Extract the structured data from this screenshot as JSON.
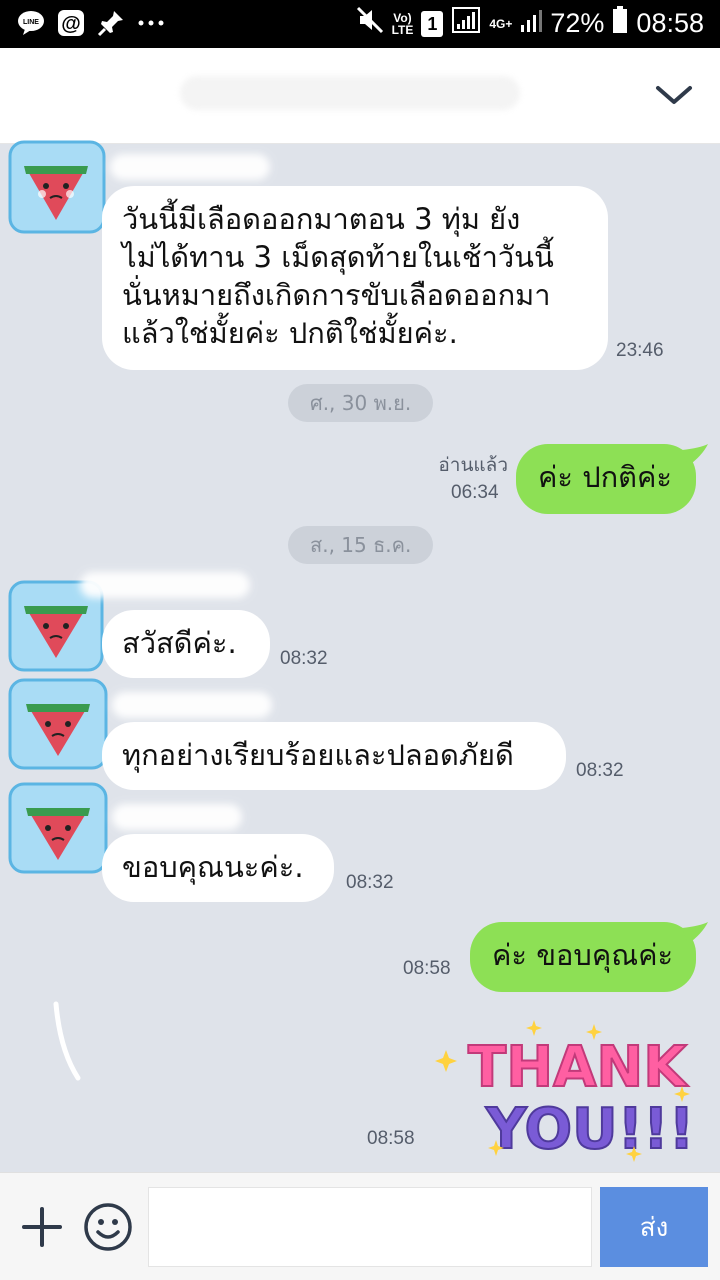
{
  "status_bar": {
    "volte_top": "Vo)",
    "volte_bottom": "LTE",
    "sim": "1",
    "network": "4G+",
    "battery": "72%",
    "time": "08:58"
  },
  "header": {
    "title": ""
  },
  "messages": {
    "m1": {
      "line1": "วันนี้มีเลือดออกมาตอน 3 ทุ่ม ยัง",
      "line2": "ไม่ได้ทาน 3 เม็ดสุดท้ายในเช้าวันนี้",
      "line3": "นั่นหมายถึงเกิดการขับเลือดออกมา",
      "line4": "แล้วใช่มั้ยค่ะ ปกติใช่มั้ยค่ะ.",
      "time": "23:46"
    },
    "date1": "ศ., 30 พ.ย.",
    "m2": {
      "text": "ค่ะ ปกติค่ะ",
      "read": "อ่านแล้ว",
      "time": "06:34"
    },
    "date2": "ส., 15 ธ.ค.",
    "m3": {
      "text": "สวัสดีค่ะ.",
      "time": "08:32"
    },
    "m4": {
      "text": "ทุกอย่างเรียบร้อยและปลอดภัยดี",
      "time": "08:32"
    },
    "m5": {
      "text": "ขอบคุณนะค่ะ.",
      "time": "08:32"
    },
    "m6": {
      "text": "ค่ะ ขอบคุณค่ะ",
      "time": "08:58"
    },
    "sticker": {
      "line1": "THANK",
      "line2": "YOU!!!",
      "time": "08:58"
    }
  },
  "input": {
    "placeholder": "",
    "send_label": "ส่ง"
  },
  "icons": {
    "plus": "plus-icon",
    "emoji": "emoji-icon",
    "chevron": "chevron-down-icon"
  },
  "colors": {
    "chat_bg": "#dfe3ea",
    "outgoing": "#8de055",
    "incoming": "#ffffff",
    "send": "#5b8ee0"
  }
}
